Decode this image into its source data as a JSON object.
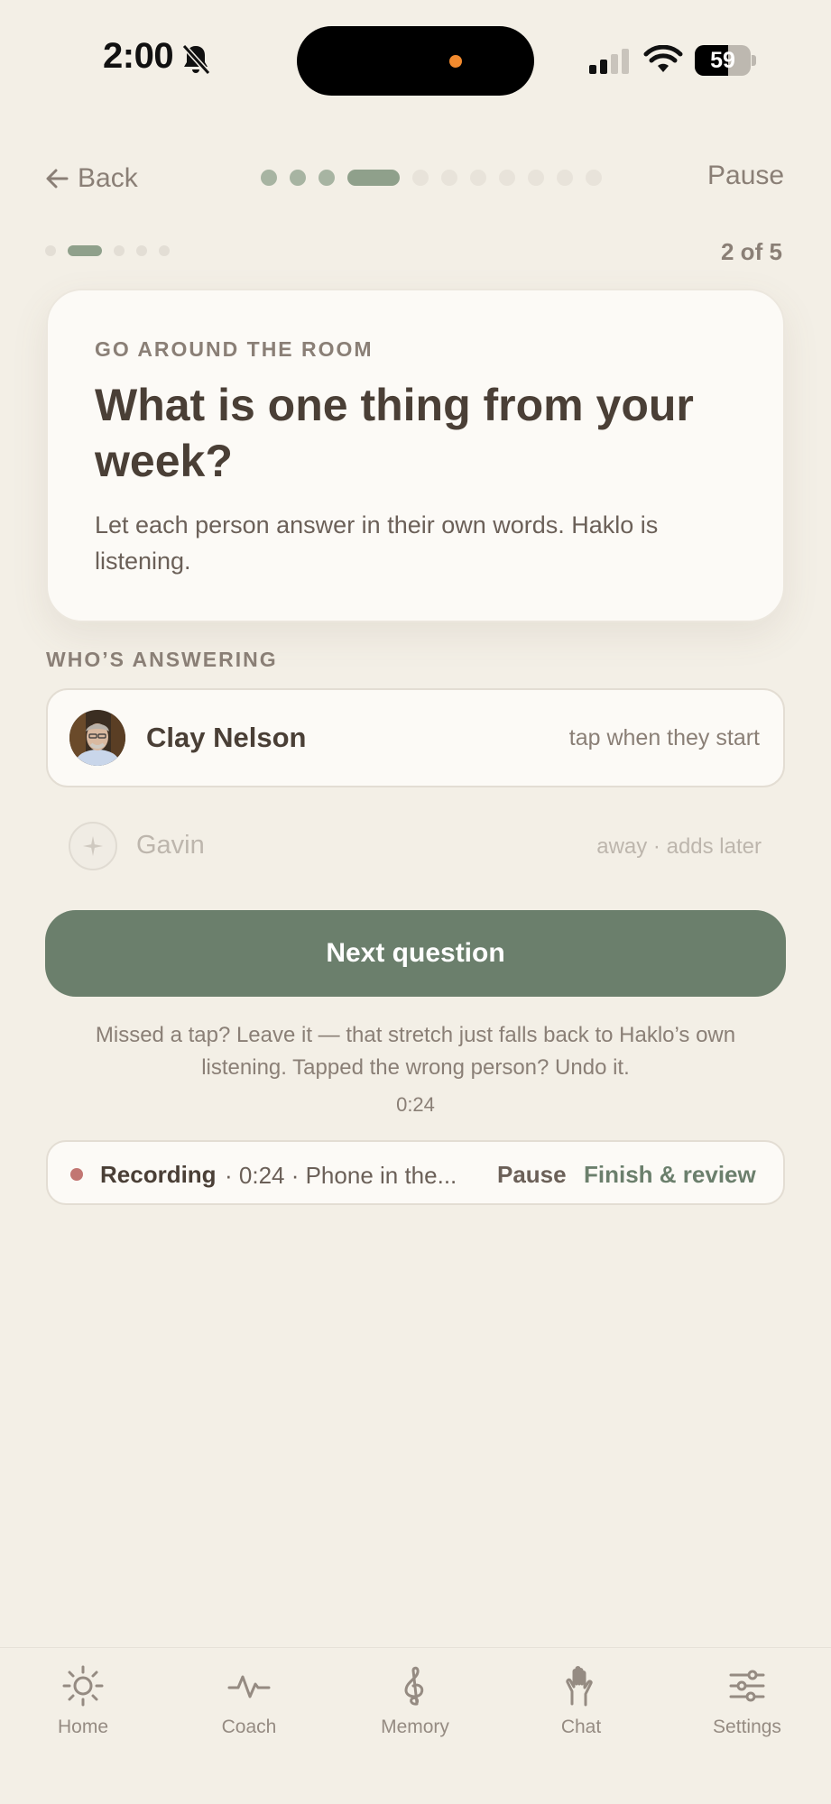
{
  "status_bar": {
    "time": "2:00",
    "battery": "59",
    "battery_level": 0.59,
    "icons": [
      "bell-slash-icon",
      "cellular-signal-icon",
      "wifi-icon",
      "battery-icon"
    ]
  },
  "nav": {
    "back_label": "Back",
    "pause_label": "Pause",
    "progress": {
      "total": 11,
      "completed": 3,
      "current": 4
    }
  },
  "sub_progress": {
    "total": 5,
    "current": 2,
    "label": "2 of 5"
  },
  "question_card": {
    "eyebrow": "GO AROUND THE ROOM",
    "title": "What is one thing from your week?",
    "description": "Let each person answer in their own words. Haklo is listening."
  },
  "answering": {
    "section_label": "WHO’S ANSWERING",
    "active_person": {
      "name": "Clay Nelson",
      "hint": "tap when they start"
    },
    "away_person": {
      "name": "Gavin",
      "hint": "away · adds later"
    }
  },
  "next_button": {
    "label": "Next question"
  },
  "helper_text": "Missed a tap? Leave it — that stretch just falls back to Haklo’s own listening. Tapped the wrong person? Undo it.",
  "timer": "0:24",
  "recording": {
    "label": "Recording",
    "detail": "· 0:24 · Phone in the...",
    "pause_label": "Pause",
    "finish_label": "Finish & review"
  },
  "tabs": [
    {
      "label": "Home",
      "icon": "sun-icon"
    },
    {
      "label": "Coach",
      "icon": "pulse-icon"
    },
    {
      "label": "Memory",
      "icon": "treble-clef-icon"
    },
    {
      "label": "Chat",
      "icon": "raised-hands-icon"
    },
    {
      "label": "Settings",
      "icon": "sliders-icon"
    }
  ],
  "colors": {
    "background": "#F3EFE6",
    "accent_green": "#6B7F6C",
    "recording_dot": "#C27672",
    "text_primary": "#4A3F36",
    "text_muted": "#8A7F76"
  }
}
